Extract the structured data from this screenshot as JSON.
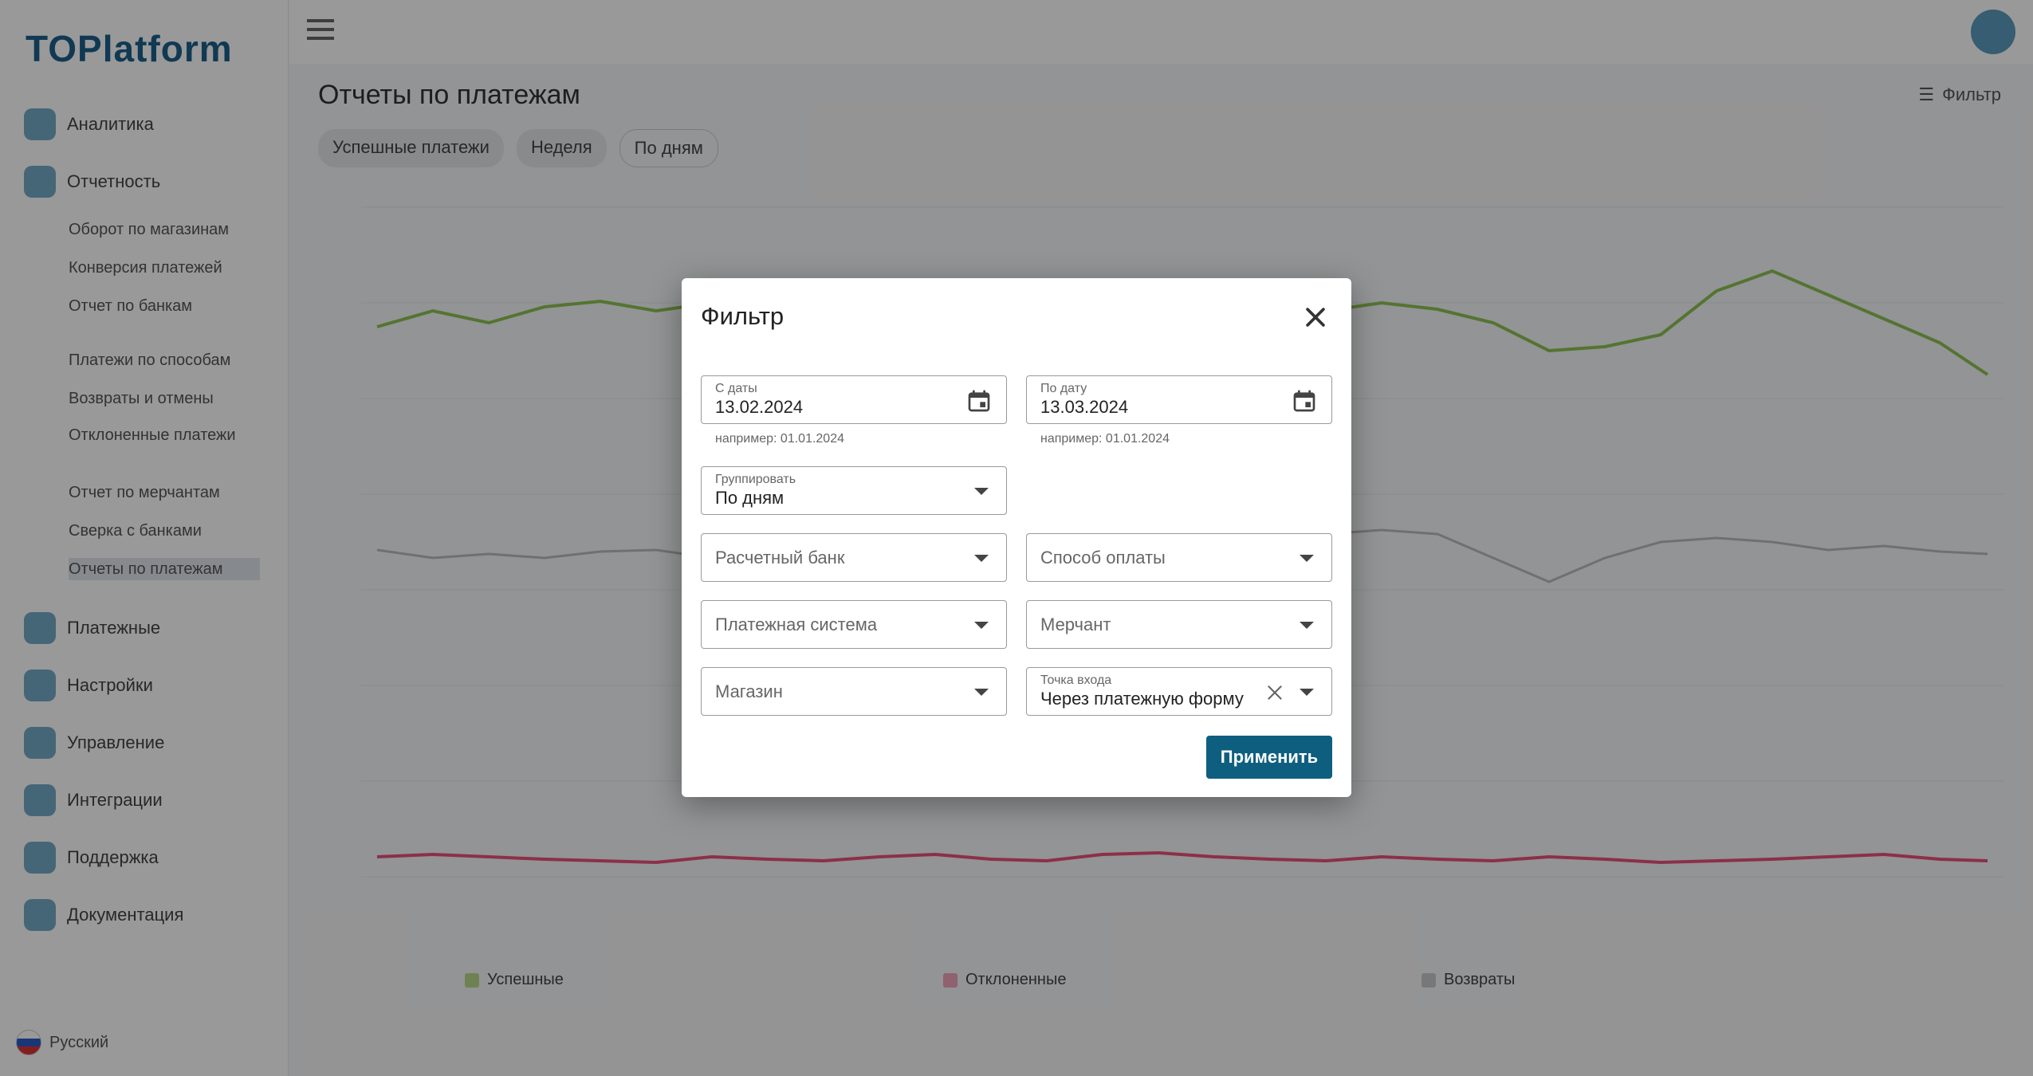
{
  "app": {
    "logo": "TOPlatform",
    "page_title": "Отчеты по платежам",
    "top_action": "Фильтр",
    "chips": [
      "Успешные платежи",
      "Неделя",
      "По дням"
    ],
    "sidebar": {
      "items": [
        {
          "label": "Аналитика"
        },
        {
          "label": "Отчетность"
        },
        {
          "label": "Платежные"
        },
        {
          "label": "Настройки"
        },
        {
          "label": "Управление"
        },
        {
          "label": "Интеграции"
        },
        {
          "label": "Поддержка"
        },
        {
          "label": "Документация"
        }
      ],
      "sub_items": [
        "Оборот по магазинам",
        "Конверсия платежей",
        "Отчет по банкам",
        "Платежи по способам",
        "Возвраты и отмены",
        "Отклоненные платежи",
        "Отчет по мерчантам",
        "Сверка с банками",
        "Отчеты по платежам"
      ],
      "language": "Русский"
    },
    "legend": [
      {
        "label": "Успешные",
        "color": "#b7d88a"
      },
      {
        "label": "Отклоненные",
        "color": "#f0a2b8"
      },
      {
        "label": "Возвраты",
        "color": "#c9c9c9"
      }
    ]
  },
  "dialog": {
    "title": "Фильтр",
    "date_from": {
      "label": "С даты",
      "value": "13.02.2024",
      "hint": "например: 01.01.2024"
    },
    "date_to": {
      "label": "По дату",
      "value": "13.03.2024",
      "hint": "например: 01.01.2024"
    },
    "group_by": {
      "label": "Группировать",
      "value": "По дням"
    },
    "settlement_bank": {
      "placeholder": "Расчетный банк"
    },
    "payment_method": {
      "placeholder": "Способ оплаты"
    },
    "payment_system": {
      "placeholder": "Платежная система"
    },
    "merchant": {
      "placeholder": "Мерчант"
    },
    "store": {
      "placeholder": "Магазин"
    },
    "entry_point": {
      "label": "Точка входа",
      "value": "Через платежную форму"
    },
    "apply_label": "Применить"
  },
  "colors": {
    "accent": "#0e5f7f",
    "success_series": "#8cc152",
    "declined_series": "#e8517a",
    "overlay": "rgba(0,0,0,0.40)"
  }
}
